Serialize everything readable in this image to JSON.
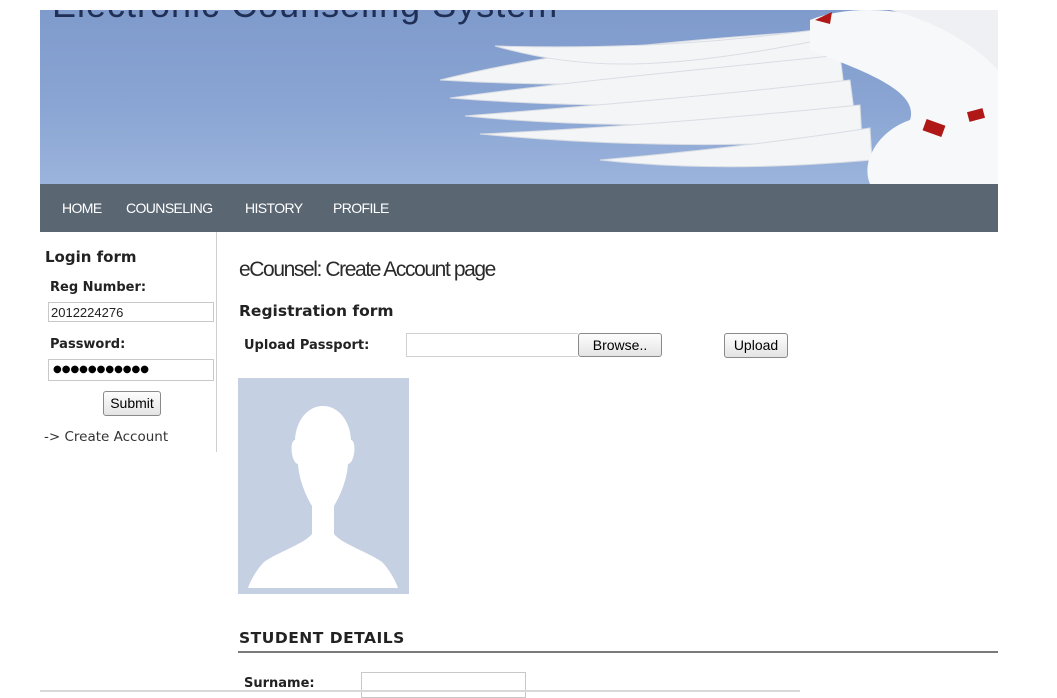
{
  "header": {
    "site_title": "Electronic Counseling System",
    "banner_image": "dove-in-flight"
  },
  "nav": {
    "items": [
      {
        "label": "HOME"
      },
      {
        "label": "COUNSELING"
      },
      {
        "label": "HISTORY"
      },
      {
        "label": "PROFILE"
      }
    ]
  },
  "login": {
    "title": "Login form",
    "reg_label": "Reg Number:",
    "reg_value": "2012224276",
    "password_label": "Password:",
    "password_mask": "●●●●●●●●●●●",
    "submit_label": "Submit",
    "create_account_link": "-> Create Account"
  },
  "main": {
    "page_heading": "eCounsel: Create Account page",
    "registration_title": "Registration form",
    "upload_label": "Upload Passport:",
    "browse_label": "Browse..",
    "upload_button": "Upload",
    "avatar_icon": "person-silhouette-icon",
    "student_details_title": "STUDENT DETAILS",
    "surname_label": "Surname:"
  },
  "colors": {
    "banner_sky": "#8aa5d3",
    "nav_background": "#5a6773",
    "avatar_background": "#c6d0e3"
  }
}
